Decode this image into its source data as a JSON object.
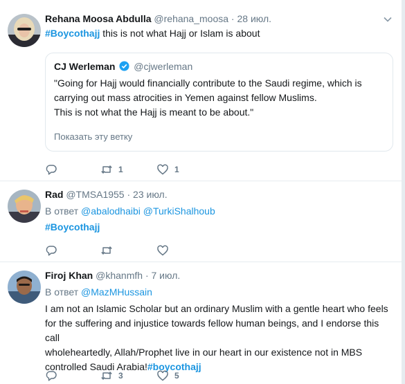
{
  "tweets": [
    {
      "name": "Rehana Moosa Abdulla",
      "handle": "@rehana_moosa",
      "sep": "·",
      "time": "28 июл.",
      "hashtag": "#Boycothajj",
      "text": " this is not what Hajj or Islam is about",
      "quote": {
        "name": "CJ Werleman",
        "handle": "@cjwerleman",
        "lines": [
          "\"Going for Hajj would financially contribute to the Saudi regime, which is",
          "carrying out mass atrocities in Yemen against fellow Muslims.",
          "This is not what the Hajj is meant to be about.\""
        ],
        "thread_link": "Показать эту ветку"
      },
      "actions": {
        "reply": "",
        "retweet": "1",
        "like": "1"
      }
    },
    {
      "name": "Rad",
      "handle": "@TMSA1955",
      "sep": "·",
      "time": "23 июл.",
      "reply_prefix": "В ответ",
      "reply_users": [
        "@abalodhaibi",
        "@TurkiShalhoub"
      ],
      "hashtag": "#Boycothajj",
      "actions": {
        "reply": "",
        "retweet": "",
        "like": ""
      }
    },
    {
      "name": "Firoj Khan",
      "handle": "@khanmfh",
      "sep": "·",
      "time": "7 июл.",
      "reply_prefix": "В ответ",
      "reply_users": [
        "@MazMHussain"
      ],
      "lines": [
        "I am not an Islamic Scholar but an ordinary Muslim with a gentle heart who feels",
        "for the suffering and injustice towards fellow human beings, and I endorse this call",
        "wholeheartedly, Allah/Prophet live in our heart in our existence not in MBS",
        "controlled Saudi Arabia!"
      ],
      "hashtag": "#boycothajj",
      "actions": {
        "reply": "",
        "retweet": "3",
        "like": "5"
      }
    }
  ],
  "colors": {
    "accent": "#1b95e0",
    "muted": "#657786",
    "border": "#e6ecf0"
  }
}
